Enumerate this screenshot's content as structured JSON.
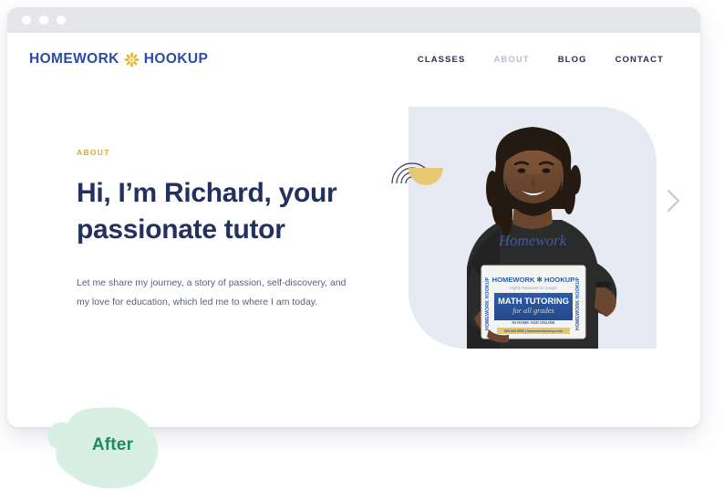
{
  "window": {
    "traffic_lights": [
      "close",
      "minimize",
      "maximize"
    ]
  },
  "header": {
    "brand": {
      "word_left": "HOMEWORK",
      "word_right": "HOOKUP",
      "icon": "flower-asterisk-icon",
      "color": "#2a4ba8",
      "icon_color": "#e8b32a"
    },
    "nav": [
      {
        "label": "CLASSES",
        "active": false
      },
      {
        "label": "ABOUT",
        "active": true
      },
      {
        "label": "BLOG",
        "active": false
      },
      {
        "label": "CONTACT",
        "active": false
      }
    ]
  },
  "hero": {
    "eyebrow": "ABOUT",
    "eyebrow_color": "#d9a441",
    "title": "Hi, I’m Richard, your passionate tutor",
    "title_color": "#22315e",
    "paragraph": "Let me share my journey, a story of passion, self-discovery, and my love for education, which led me to where I am today.",
    "media": {
      "card_background": "#e8eaf3",
      "alt": "Smiling tutor holding a Homework Hookup math tutoring sign",
      "sign": {
        "brand_left": "HOMEWORK",
        "brand_right": "HOOKUP",
        "tagline": "Highly Reviewed on Google",
        "headline": "MATH TUTORING",
        "script": "for all grades",
        "subline": "IN HOME AND ONLINE",
        "side_text": "HOMEWORK HOOKUP"
      },
      "shirt_text": "Homework"
    },
    "decor": {
      "arcs_color": "#3d4466",
      "half_disc_color": "#e6c872"
    },
    "next_arrow_icon": "chevron-right-icon",
    "next_arrow_color": "#c3c7dc"
  },
  "badge": {
    "label": "After",
    "text_color": "#1f8a63",
    "blob_color": "#d8f0e4"
  }
}
